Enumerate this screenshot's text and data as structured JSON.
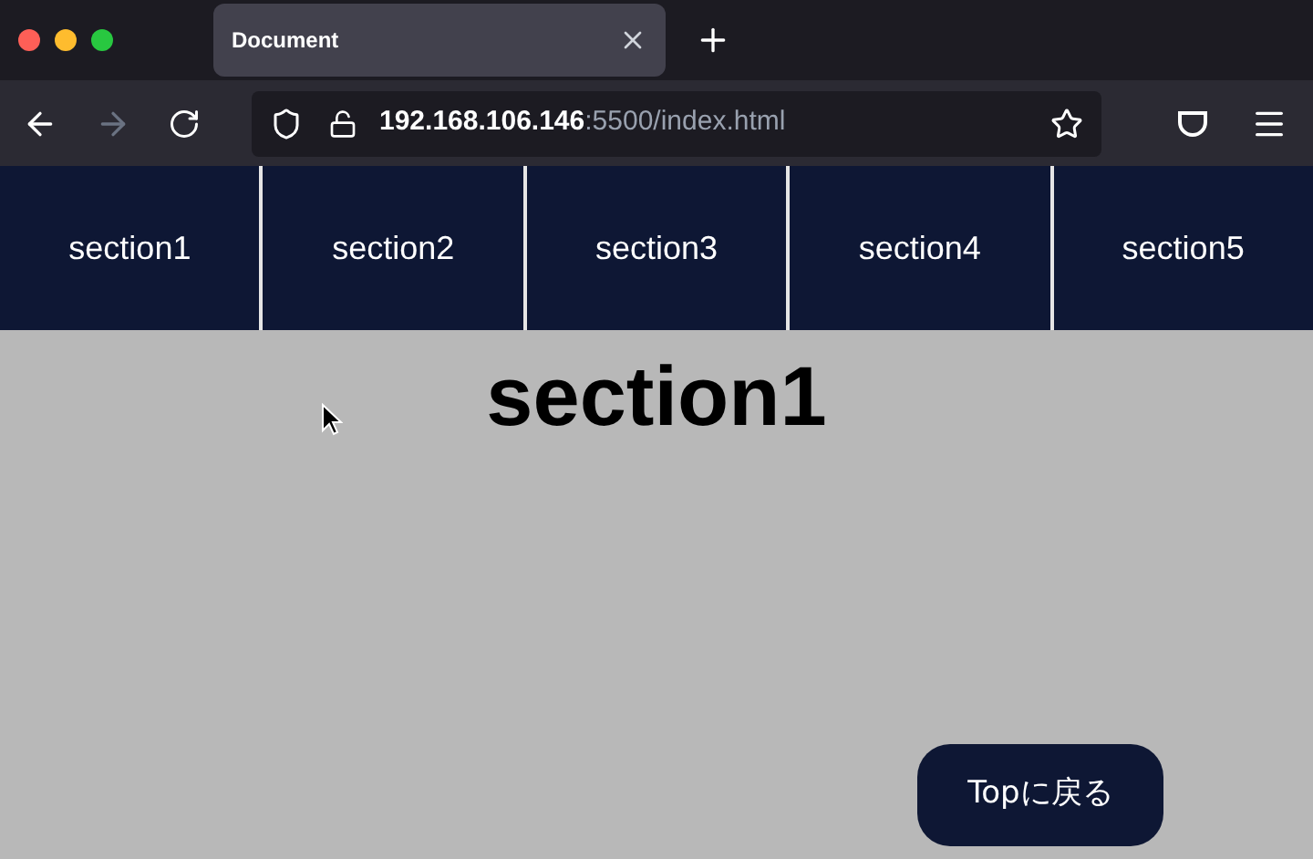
{
  "browser": {
    "tab": {
      "title": "Document",
      "selected": true
    },
    "url": {
      "host": "192.168.106.146",
      "path": ":5500/index.html"
    }
  },
  "nav": {
    "items": [
      {
        "label": "section1"
      },
      {
        "label": "section2"
      },
      {
        "label": "section3"
      },
      {
        "label": "section4"
      },
      {
        "label": "section5"
      }
    ]
  },
  "heading": "section1",
  "top_button": "Topに戻る"
}
